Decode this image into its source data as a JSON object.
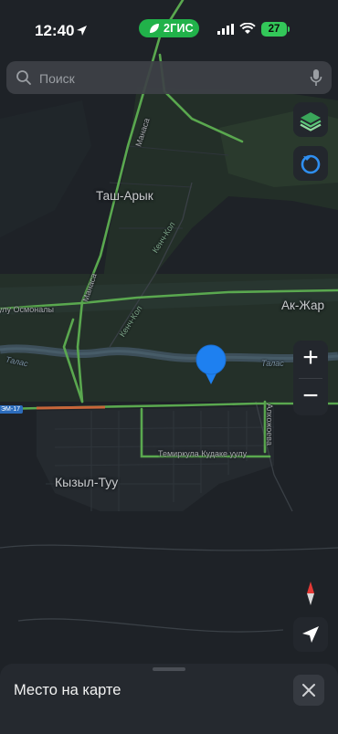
{
  "status_bar": {
    "time": "12:40",
    "brand": "2ГИС",
    "battery": "27"
  },
  "search": {
    "placeholder": "Поиск"
  },
  "map": {
    "places": [
      "Таш-Арык",
      "Ак-Жар",
      "Кызыл-Туу"
    ],
    "streets": [
      "Манаса",
      "Манаса",
      "Кенч-Кол",
      "Кенч-Кол",
      "улу Осмоналы",
      "Талас",
      "Талас",
      "Алкожоева",
      "Темиркула Кудаке уулу"
    ],
    "highway_shield": "ЭМ-17",
    "colors": {
      "background": "#1e2227",
      "roads_green": "#5aa84f",
      "roads_orange": "#c8663a",
      "river": "#3d4f5a",
      "pin": "#1e80f0"
    }
  },
  "controls": {
    "zoom_in": "+",
    "zoom_out": "−",
    "icons": [
      "search-icon",
      "mic-icon",
      "layers-icon",
      "compass-mode-icon",
      "north-compass-icon",
      "locate-arrow-icon",
      "close-icon"
    ]
  },
  "bottom_sheet": {
    "title": "Место на карте"
  }
}
